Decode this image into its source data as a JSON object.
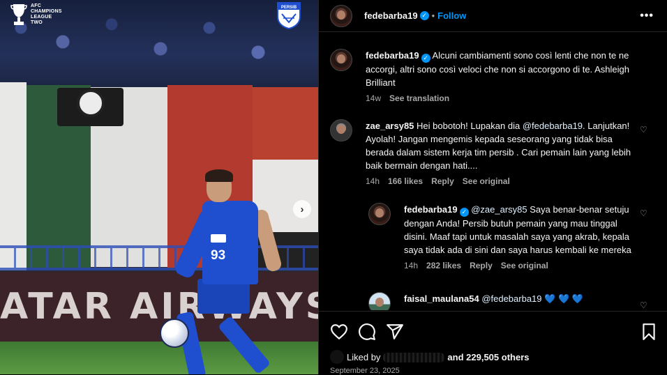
{
  "photo": {
    "acl_logo_text": "AFC\nCHAMPIONS\nLEAGUE\nTWO",
    "persib_text": "PERSIB",
    "ad_text": "ATAR AIRWAYS",
    "jersey_number": "93",
    "next_glyph": "›"
  },
  "header": {
    "username": "fedebarba19",
    "verified_glyph": "✓",
    "dot": "•",
    "follow_label": "Follow",
    "more_glyph": "•••"
  },
  "caption": {
    "username": "fedebarba19",
    "text": "Alcuni cambiamenti sono così lenti che non te ne accorgi, altri sono così veloci che non si accorgono di te. Ashleigh Brilliant",
    "time": "14w",
    "see_translation": "See translation"
  },
  "comments": [
    {
      "username": "zae_arsy85",
      "text_before": "Hei bobotoh! Lupakan dia ",
      "mention": "@fedebarba19",
      "text_after": ". Lanjutkan! Ayolah! Jangan mengemis kepada seseorang yang tidak bisa berada dalam sistem kerja tim persib . Cari pemain lain yang lebih baik bermain dengan hati....",
      "time": "14h",
      "likes": "166 likes",
      "reply": "Reply",
      "see_original": "See original"
    },
    {
      "username": "fedebarba19",
      "mention": "@zae_arsy85",
      "text_after": " Saya benar-benar setuju dengan Anda! Persib butuh pemain yang mau tinggal disini. Maaf tapi untuk masalah saya yang akrab, kepala saya tidak ada di sini dan saya harus kembali ke mereka",
      "time": "14h",
      "likes": "282 likes",
      "reply": "Reply",
      "see_original": "See original"
    },
    {
      "username": "faisal_maulana54",
      "mention": "@fedebarba19",
      "text_after": " 💙 💙 💙"
    }
  ],
  "heart_glyph": "♡",
  "actions": {
    "liked_by": "Liked by",
    "and_others": "and 229,505 others",
    "date": "September 23, 2025"
  }
}
